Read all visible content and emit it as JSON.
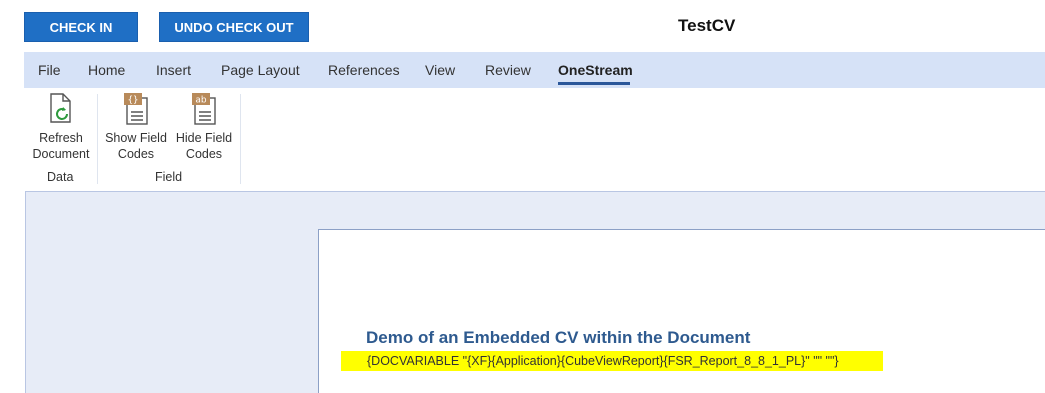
{
  "toolbar": {
    "check_in_label": "CHECK IN",
    "undo_checkout_label": "UNDO CHECK OUT"
  },
  "document_title": "TestCV",
  "tabs": [
    "File",
    "Home",
    "Insert",
    "Page Layout",
    "References",
    "View",
    "Review",
    "OneStream"
  ],
  "active_tab": "OneStream",
  "ribbon": {
    "refresh": {
      "line1": "Refresh",
      "line2": "Document",
      "icon": "refresh-document-icon"
    },
    "show_field": {
      "line1": "Show Field",
      "line2": "Codes",
      "icon": "show-field-codes-icon"
    },
    "hide_field": {
      "line1": "Hide Field",
      "line2": "Codes",
      "icon": "hide-field-codes-icon"
    },
    "groups": {
      "data": "Data",
      "field": "Field"
    }
  },
  "document": {
    "heading": "Demo of an Embedded CV within the Document",
    "field_code": "{DOCVARIABLE \"{XF}{Application}{CubeViewReport}{FSR_Report_8_8_1_PL}\" \"\" \"\"}"
  },
  "colors": {
    "accent": "#1f6fc5",
    "tabbar": "#d6e2f7",
    "highlight": "#ffff00",
    "heading": "#2e5a8f"
  }
}
